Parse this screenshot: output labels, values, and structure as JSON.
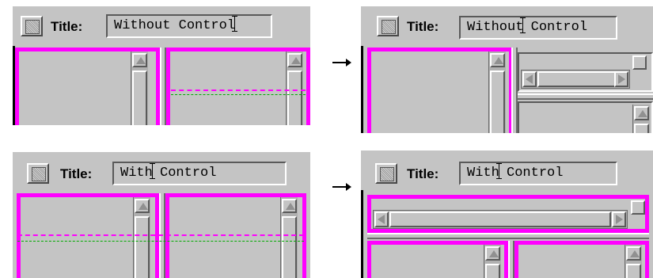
{
  "panels": {
    "top_left": {
      "title_label": "Title:",
      "field_value": "Without Control"
    },
    "top_right": {
      "title_label": "Title:",
      "field_before_cursor": "Without",
      "field_after_cursor": " Control"
    },
    "bottom_left": {
      "title_label": "Title:",
      "field_before_cursor": "With",
      "field_after_cursor": " Control"
    },
    "bottom_right": {
      "title_label": "Title:",
      "field_before_cursor": "With",
      "field_after_cursor": " Control"
    }
  },
  "colors": {
    "accent": "#ff00ff",
    "guide": "#00aa00",
    "panel_bg": "#c4c4c4"
  },
  "icons": [
    "title-button-icon",
    "arrow-right-icon",
    "scroll-up-arrow-icon",
    "scroll-left-arrow-icon",
    "scroll-right-arrow-icon"
  ]
}
